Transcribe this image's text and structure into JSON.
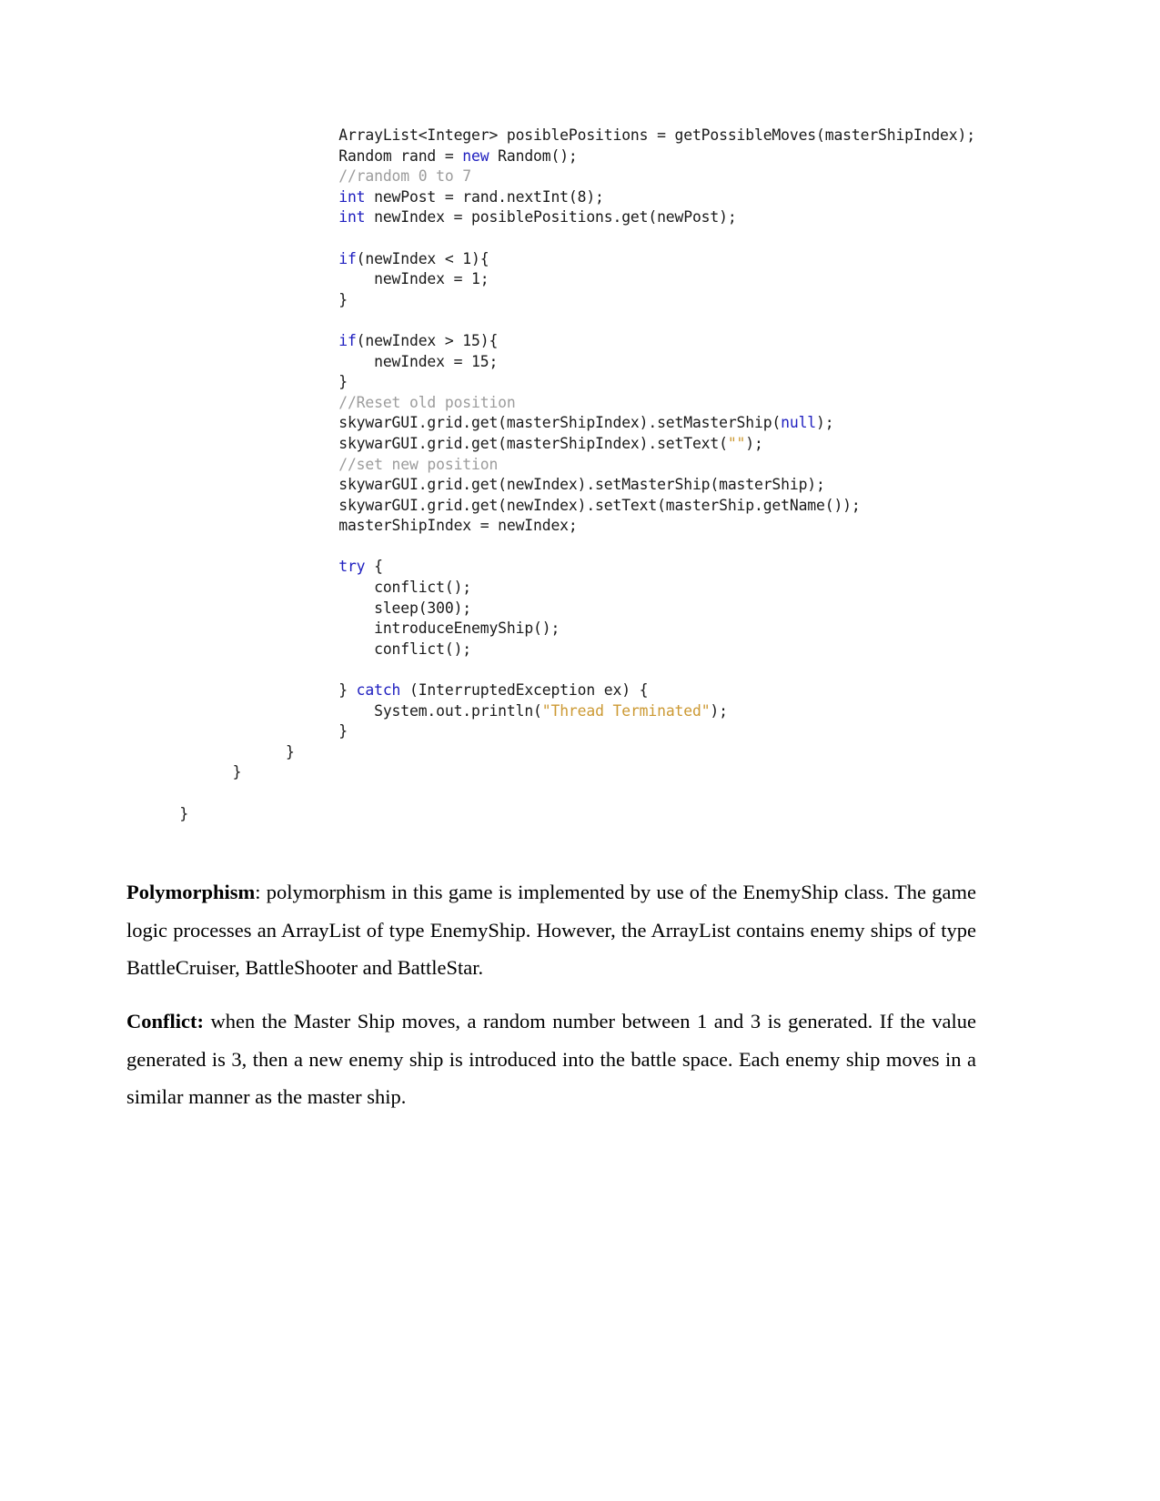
{
  "document": {
    "code_block": {
      "language": "java",
      "lines": [
        {
          "indent": 24,
          "segments": [
            {
              "t": "ArrayList<Integer> posiblePositions = getPossibleMoves(masterShipIndex);",
              "c": "plain"
            }
          ]
        },
        {
          "indent": 24,
          "segments": [
            {
              "t": "Random rand = ",
              "c": "plain"
            },
            {
              "t": "new",
              "c": "kw"
            },
            {
              "t": " Random();",
              "c": "plain"
            }
          ]
        },
        {
          "indent": 24,
          "segments": [
            {
              "t": "//random 0 to 7",
              "c": "cmt"
            }
          ]
        },
        {
          "indent": 24,
          "segments": [
            {
              "t": "int",
              "c": "kw"
            },
            {
              "t": " newPost = rand.nextInt(8);",
              "c": "plain"
            }
          ]
        },
        {
          "indent": 24,
          "segments": [
            {
              "t": "int",
              "c": "kw"
            },
            {
              "t": " newIndex = posiblePositions.get(newPost);",
              "c": "plain"
            }
          ]
        },
        {
          "indent": 0,
          "blank": true,
          "segments": []
        },
        {
          "indent": 24,
          "segments": [
            {
              "t": "if",
              "c": "kw"
            },
            {
              "t": "(newIndex < 1){",
              "c": "plain"
            }
          ]
        },
        {
          "indent": 24,
          "segments": [
            {
              "t": "    newIndex = 1;",
              "c": "plain"
            }
          ]
        },
        {
          "indent": 24,
          "segments": [
            {
              "t": "}",
              "c": "plain"
            }
          ]
        },
        {
          "indent": 0,
          "blank": true,
          "segments": []
        },
        {
          "indent": 24,
          "segments": [
            {
              "t": "if",
              "c": "kw"
            },
            {
              "t": "(newIndex > 15){",
              "c": "plain"
            }
          ]
        },
        {
          "indent": 24,
          "segments": [
            {
              "t": "    newIndex = 15;",
              "c": "plain"
            }
          ]
        },
        {
          "indent": 24,
          "segments": [
            {
              "t": "}",
              "c": "plain"
            }
          ]
        },
        {
          "indent": 24,
          "segments": [
            {
              "t": "//Reset old position",
              "c": "cmt"
            }
          ]
        },
        {
          "indent": 24,
          "segments": [
            {
              "t": "skywarGUI.grid.get(masterShipIndex).setMasterShip(",
              "c": "plain"
            },
            {
              "t": "null",
              "c": "kw"
            },
            {
              "t": ");",
              "c": "plain"
            }
          ]
        },
        {
          "indent": 24,
          "segments": [
            {
              "t": "skywarGUI.grid.get(masterShipIndex).setText(",
              "c": "plain"
            },
            {
              "t": "\"\"",
              "c": "str"
            },
            {
              "t": ");",
              "c": "plain"
            }
          ]
        },
        {
          "indent": 24,
          "segments": [
            {
              "t": "//set new position",
              "c": "cmt"
            }
          ]
        },
        {
          "indent": 24,
          "segments": [
            {
              "t": "skywarGUI.grid.get(newIndex).setMasterShip(masterShip);",
              "c": "plain"
            }
          ]
        },
        {
          "indent": 24,
          "segments": [
            {
              "t": "skywarGUI.grid.get(newIndex).setText(masterShip.getName());",
              "c": "plain"
            }
          ]
        },
        {
          "indent": 24,
          "segments": [
            {
              "t": "masterShipIndex = newIndex;",
              "c": "plain"
            }
          ]
        },
        {
          "indent": 0,
          "blank": true,
          "segments": []
        },
        {
          "indent": 24,
          "segments": [
            {
              "t": "try",
              "c": "kw"
            },
            {
              "t": " {",
              "c": "plain"
            }
          ]
        },
        {
          "indent": 24,
          "segments": [
            {
              "t": "    conflict();",
              "c": "plain"
            }
          ]
        },
        {
          "indent": 24,
          "segments": [
            {
              "t": "    sleep(300);",
              "c": "plain"
            }
          ]
        },
        {
          "indent": 24,
          "segments": [
            {
              "t": "    introduceEnemyShip();",
              "c": "plain"
            }
          ]
        },
        {
          "indent": 24,
          "segments": [
            {
              "t": "    conflict();",
              "c": "plain"
            }
          ]
        },
        {
          "indent": 0,
          "blank": true,
          "segments": []
        },
        {
          "indent": 24,
          "segments": [
            {
              "t": "} ",
              "c": "plain"
            },
            {
              "t": "catch",
              "c": "kw"
            },
            {
              "t": " (InterruptedException ex) {",
              "c": "plain"
            }
          ]
        },
        {
          "indent": 24,
          "segments": [
            {
              "t": "    System.out.println(",
              "c": "plain"
            },
            {
              "t": "\"Thread Terminated\"",
              "c": "str"
            },
            {
              "t": ");",
              "c": "plain"
            }
          ]
        },
        {
          "indent": 24,
          "segments": [
            {
              "t": "}",
              "c": "plain"
            }
          ]
        },
        {
          "indent": 18,
          "segments": [
            {
              "t": "}",
              "c": "plain"
            }
          ]
        },
        {
          "indent": 12,
          "segments": [
            {
              "t": "}",
              "c": "plain"
            }
          ]
        },
        {
          "indent": 0,
          "blank": true,
          "segments": []
        },
        {
          "indent": 6,
          "segments": [
            {
              "t": "}",
              "c": "plain"
            }
          ]
        }
      ]
    },
    "paragraphs": [
      {
        "id": "polymorphism",
        "lead": "Polymorphism",
        "lead_suffix": ": ",
        "body": "polymorphism in this game is implemented by use of the EnemyShip class. The game logic processes an ArrayList of type EnemyShip. However, the ArrayList contains enemy ships of type BattleCruiser, BattleShooter and BattleStar."
      },
      {
        "id": "conflict",
        "lead": "Conflict:",
        "lead_suffix": " ",
        "body": "when the Master Ship moves, a random number between 1 and 3 is generated. If the value generated is 3, then a new enemy ship is introduced into the battle space. Each enemy ship moves in a similar manner as the master ship."
      }
    ]
  },
  "colors": {
    "keyword": "#2020c0",
    "comment": "#9c9c9c",
    "string": "#cc9933",
    "text": "#000000",
    "background": "#ffffff"
  }
}
